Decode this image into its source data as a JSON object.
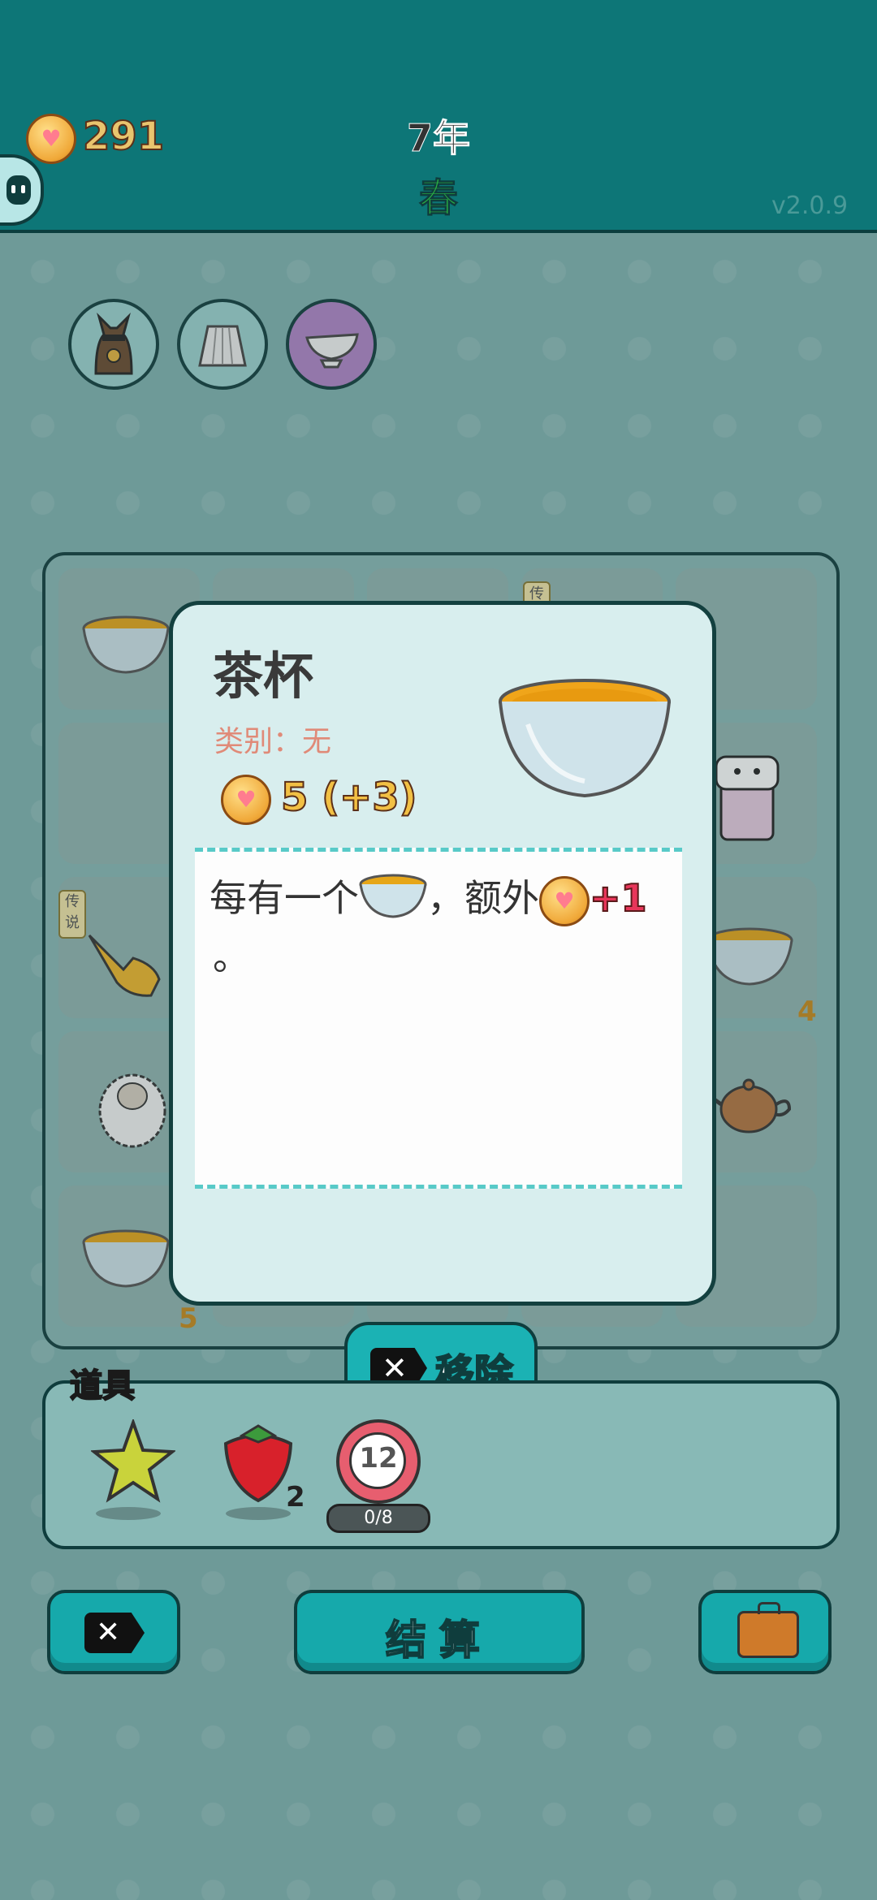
{
  "header": {
    "coins": "291",
    "year": "7年",
    "season": "春",
    "version": "v2.0.9"
  },
  "popup": {
    "title": "茶杯",
    "category": "类别：无",
    "value": "5 (+3)",
    "description_part1": "每有一个",
    "description_part2": "，额外",
    "description_bonus": "+1",
    "description_end": "。"
  },
  "board": {
    "tag_legend": "传说",
    "counts": {
      "bowl_bottom_left": "5",
      "bowl_right": "4"
    }
  },
  "remove_button": {
    "label": "移除"
  },
  "items_panel": {
    "title": "道具",
    "strawberry_count": "2",
    "ticket_number": "12",
    "ticket_progress": "0/8"
  },
  "bottom_bar": {
    "settle_label": "结算"
  },
  "colors": {
    "header_bg": "#0d7677",
    "accent": "#16a9ab",
    "season_green": "#2bb543",
    "coin_gold": "#f0a838"
  }
}
